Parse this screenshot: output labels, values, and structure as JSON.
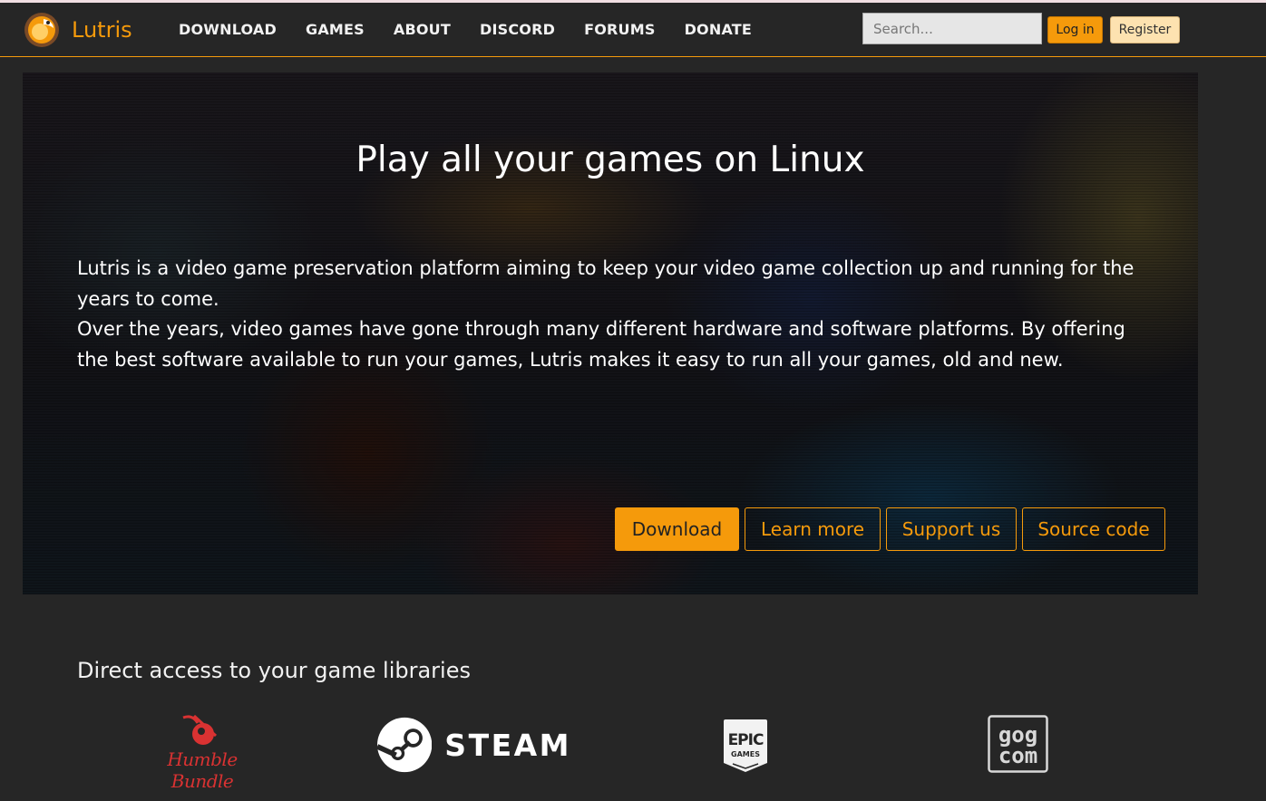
{
  "brand": {
    "name": "Lutris",
    "logo": "lutris-logo"
  },
  "nav": {
    "links": [
      "DOWNLOAD",
      "GAMES",
      "ABOUT",
      "DISCORD",
      "FORUMS",
      "DONATE"
    ],
    "search_placeholder": "Search...",
    "login_label": "Log in",
    "register_label": "Register"
  },
  "hero": {
    "title": "Play all your games on Linux",
    "paragraphs": [
      "Lutris is a video game preservation platform aiming to keep your video game collection up and running for the years to come.",
      "Over the years, video games have gone through many different hardware and software platforms. By offering the best software available to run your games, Lutris makes it easy to run all your games, old and new."
    ],
    "buttons": [
      "Download",
      "Learn more",
      "Support us",
      "Source code"
    ]
  },
  "libraries": {
    "title": "Direct access to your game libraries",
    "items": [
      {
        "name": "Humble Bundle",
        "icon": "humble-bundle-logo"
      },
      {
        "name": "STEAM",
        "icon": "steam-logo"
      },
      {
        "name": "EPIC",
        "sub": "GAMES",
        "icon": "epic-games-logo"
      },
      {
        "name": "gog",
        "sub": "com",
        "icon": "gog-logo"
      }
    ]
  },
  "colors": {
    "accent": "#f59a0b",
    "background": "#262626",
    "humble_red": "#d93232"
  }
}
